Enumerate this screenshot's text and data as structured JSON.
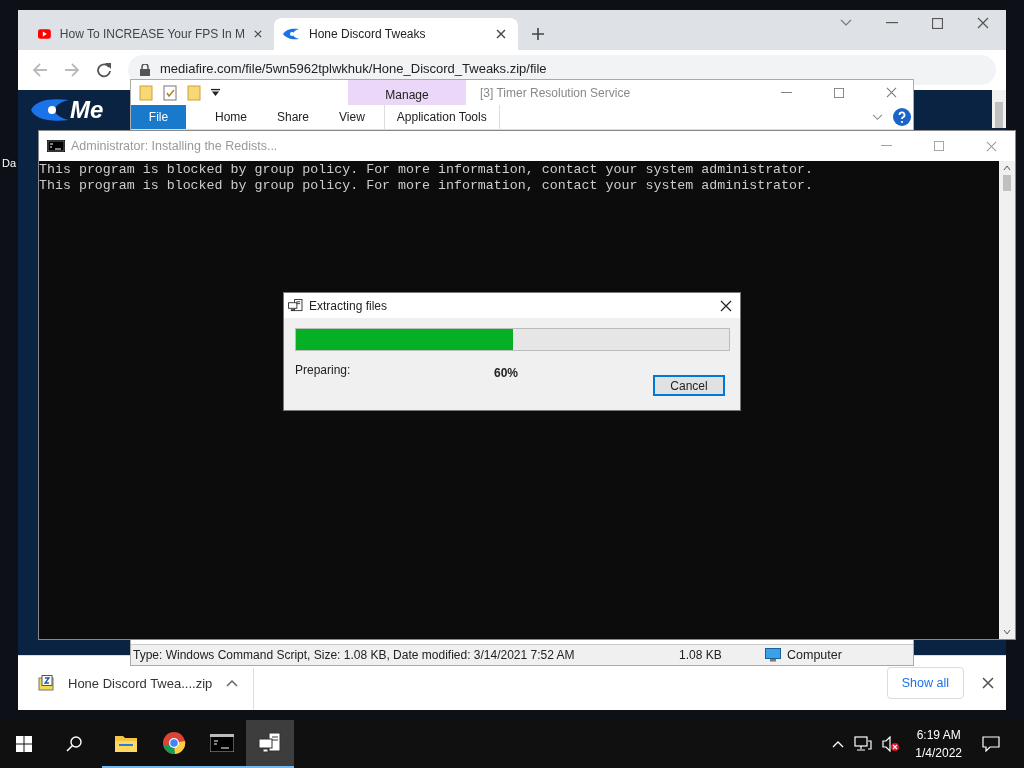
{
  "desktop": {
    "icon_label": "Da"
  },
  "browser": {
    "tabs": [
      {
        "title": "How To INCREASE Your FPS In M",
        "kind": "video",
        "selected": false
      },
      {
        "title": "Hone Discord Tweaks",
        "kind": "site",
        "selected": true
      }
    ],
    "address": "mediafire.com/file/5wn5962tplwkhuk/Hone_Discord_Tweaks.zip/file",
    "logo_text": "Me",
    "download": {
      "file": "Hone Discord Twea....zip",
      "show_all": "Show all"
    }
  },
  "explorer": {
    "context_group": "Manage",
    "title": "[3] Timer Resolution Service",
    "ribbon_tabs": [
      {
        "label": "File",
        "kind": "file"
      },
      {
        "label": "Home",
        "kind": "tab"
      },
      {
        "label": "Share",
        "kind": "tab"
      },
      {
        "label": "View",
        "kind": "tab"
      },
      {
        "label": "Application Tools",
        "kind": "context"
      }
    ],
    "status": {
      "details": "Type: Windows Command Script, Size: 1.08 KB, Date modified: 3/14/2021 7:52 AM",
      "size": "1.08 KB",
      "location": "Computer"
    }
  },
  "console": {
    "title": "Administrator:  Installing the Redists...",
    "lines": [
      "This program is blocked by group policy. For more information, contact your system administrator.",
      "This program is blocked by group policy. For more information, contact your system administrator."
    ]
  },
  "dialog": {
    "title": "Extracting files",
    "level": 0.5,
    "status": "Preparing:",
    "percent": "60%",
    "button": "Cancel"
  },
  "taskbar": {
    "apps": [
      {
        "kind": "folder",
        "active": false
      },
      {
        "kind": "browser",
        "active": false
      },
      {
        "kind": "console",
        "active": false
      },
      {
        "kind": "installer",
        "active": true
      }
    ],
    "time": "6:19 AM",
    "date": "1/4/2022"
  }
}
